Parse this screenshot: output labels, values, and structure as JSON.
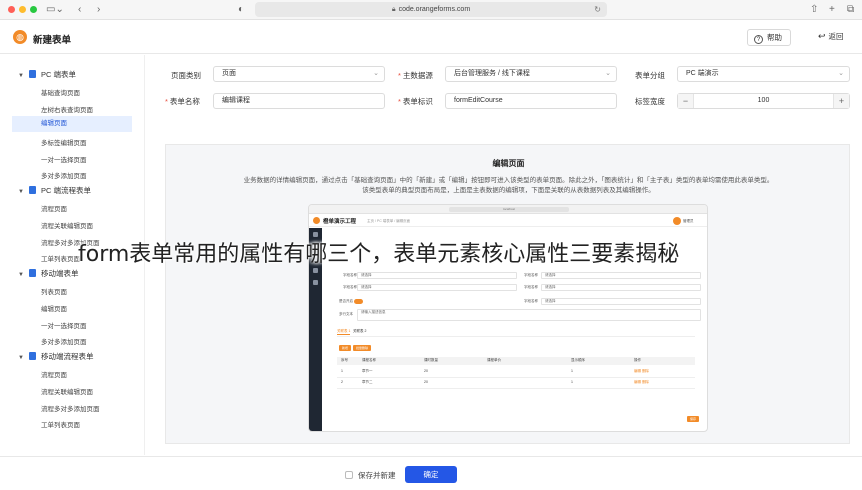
{
  "browser": {
    "url": "code.orangeforms.com"
  },
  "app": {
    "title": "新建表单",
    "help_label": "帮助",
    "back_label": "返回"
  },
  "sidebar": {
    "groups": [
      {
        "label": "PC 端表单",
        "items": [
          "基础查询页面",
          "左树右表查询页面",
          "编辑页面",
          "多标签编辑页面",
          "一对一选择页面",
          "多对多添加页面"
        ]
      },
      {
        "label": "PC 端流程表单",
        "items": [
          "流程页面",
          "流程关联编辑页面",
          "流程多对多添加页面",
          "工单列表页面"
        ]
      },
      {
        "label": "移动端表单",
        "items": [
          "列表页面",
          "编辑页面",
          "一对一选择页面",
          "多对多添加页面"
        ]
      },
      {
        "label": "移动端流程表单",
        "items": [
          "流程页面",
          "流程关联编辑页面",
          "流程多对多添加页面",
          "工单列表页面"
        ]
      }
    ],
    "active_item": "编辑页面"
  },
  "form": {
    "page_type_label": "页面类别",
    "page_type_value": "页面",
    "datasource_label": "主数据源",
    "datasource_value": "后台管理服务 / 线下课程",
    "group_label": "表单分组",
    "group_value": "PC 端演示",
    "name_label": "表单名称",
    "name_value": "编辑课程",
    "id_label": "表单标识",
    "id_value": "formEditCourse",
    "label_width_label": "标签宽度",
    "label_width_value": "100"
  },
  "preview": {
    "title": "编辑页面",
    "desc1": "业务数据的详情编辑页面，通过点击「基础查询页面」中的「新建」或「编辑」按钮即可进入该类型的表单页面。除此之外，「图表统计」和「主子表」类型的表单均需使用此表单类型。",
    "desc2": "该类型表单的典型页面布局是，上面是主表数据的编辑项，下面是关联的从表数据列表及其编辑操作。",
    "mini": {
      "url": "localhost",
      "title": "橙单演示工程",
      "crumb": "主页  /  PC 端表单  /  编辑页面",
      "user": "管理员",
      "row_labels": [
        "字段名称",
        "字段名称",
        "字段名称",
        "字段名称",
        "字段名称",
        "字段名称",
        "是否开启"
      ],
      "values": [
        "请选择",
        "请选择",
        "请选择",
        "请选择",
        "请选择",
        "请输入"
      ],
      "remark_label": "多行文本",
      "remark_value": "请输入描述信息",
      "tabs": [
        "关联表 1",
        "关联表 2"
      ],
      "btn_add": "新增",
      "btn_batch": "批量删除",
      "headers": [
        "序号",
        "课程名称",
        "课时数量",
        "课程单价",
        "显示顺序",
        "操作"
      ],
      "rows": [
        [
          "1",
          "章节一",
          "20",
          "",
          "1",
          "编辑  删除"
        ],
        [
          "2",
          "章节二",
          "20",
          "",
          "1",
          "编辑  删除"
        ]
      ],
      "save": "保存"
    }
  },
  "overlay": {
    "text": "form表单常用的属性有哪三个，表单元素核心属性三要素揭秘"
  },
  "footer": {
    "continue_label": "保存并新建",
    "confirm_label": "确定"
  },
  "colors": {
    "primary": "#2457e6",
    "accent": "#f28b28",
    "active_bg": "#e6efff"
  }
}
